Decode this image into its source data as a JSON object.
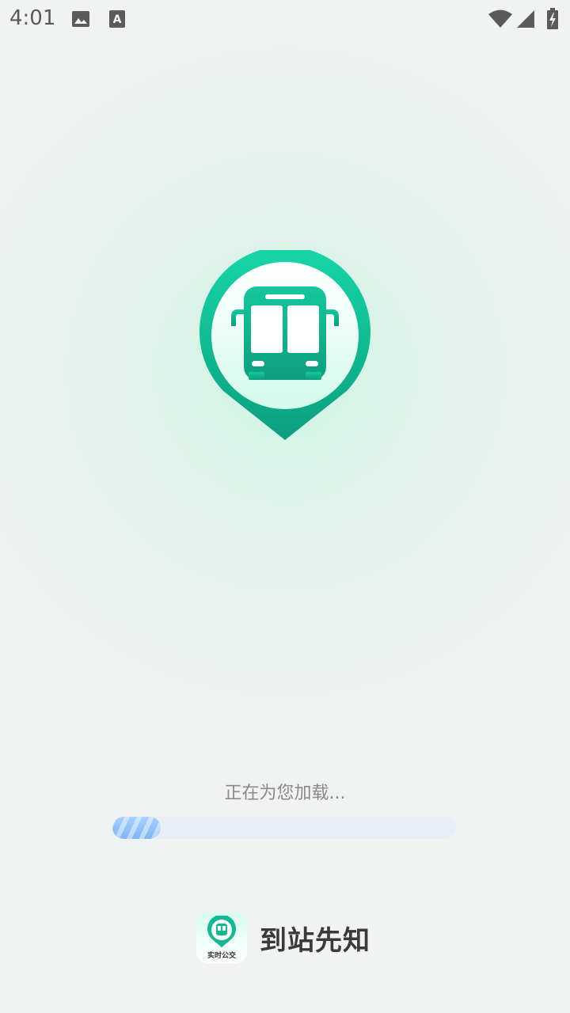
{
  "status_bar": {
    "time": "4:01",
    "icons": [
      "image-icon",
      "font-a-icon",
      "wifi-icon",
      "signal-icon",
      "battery-charging-icon"
    ]
  },
  "splash": {
    "logo_icon": "bus-location-pin-icon",
    "accent_color": "#12b894",
    "accent_dark": "#0c9e80"
  },
  "loading": {
    "text": "正在为您加载...",
    "progress_percent": 14,
    "bar_color": "#8fc2fa",
    "track_color": "#e8eef6"
  },
  "brand": {
    "icon_label": "实时公交",
    "name": "到站先知"
  }
}
